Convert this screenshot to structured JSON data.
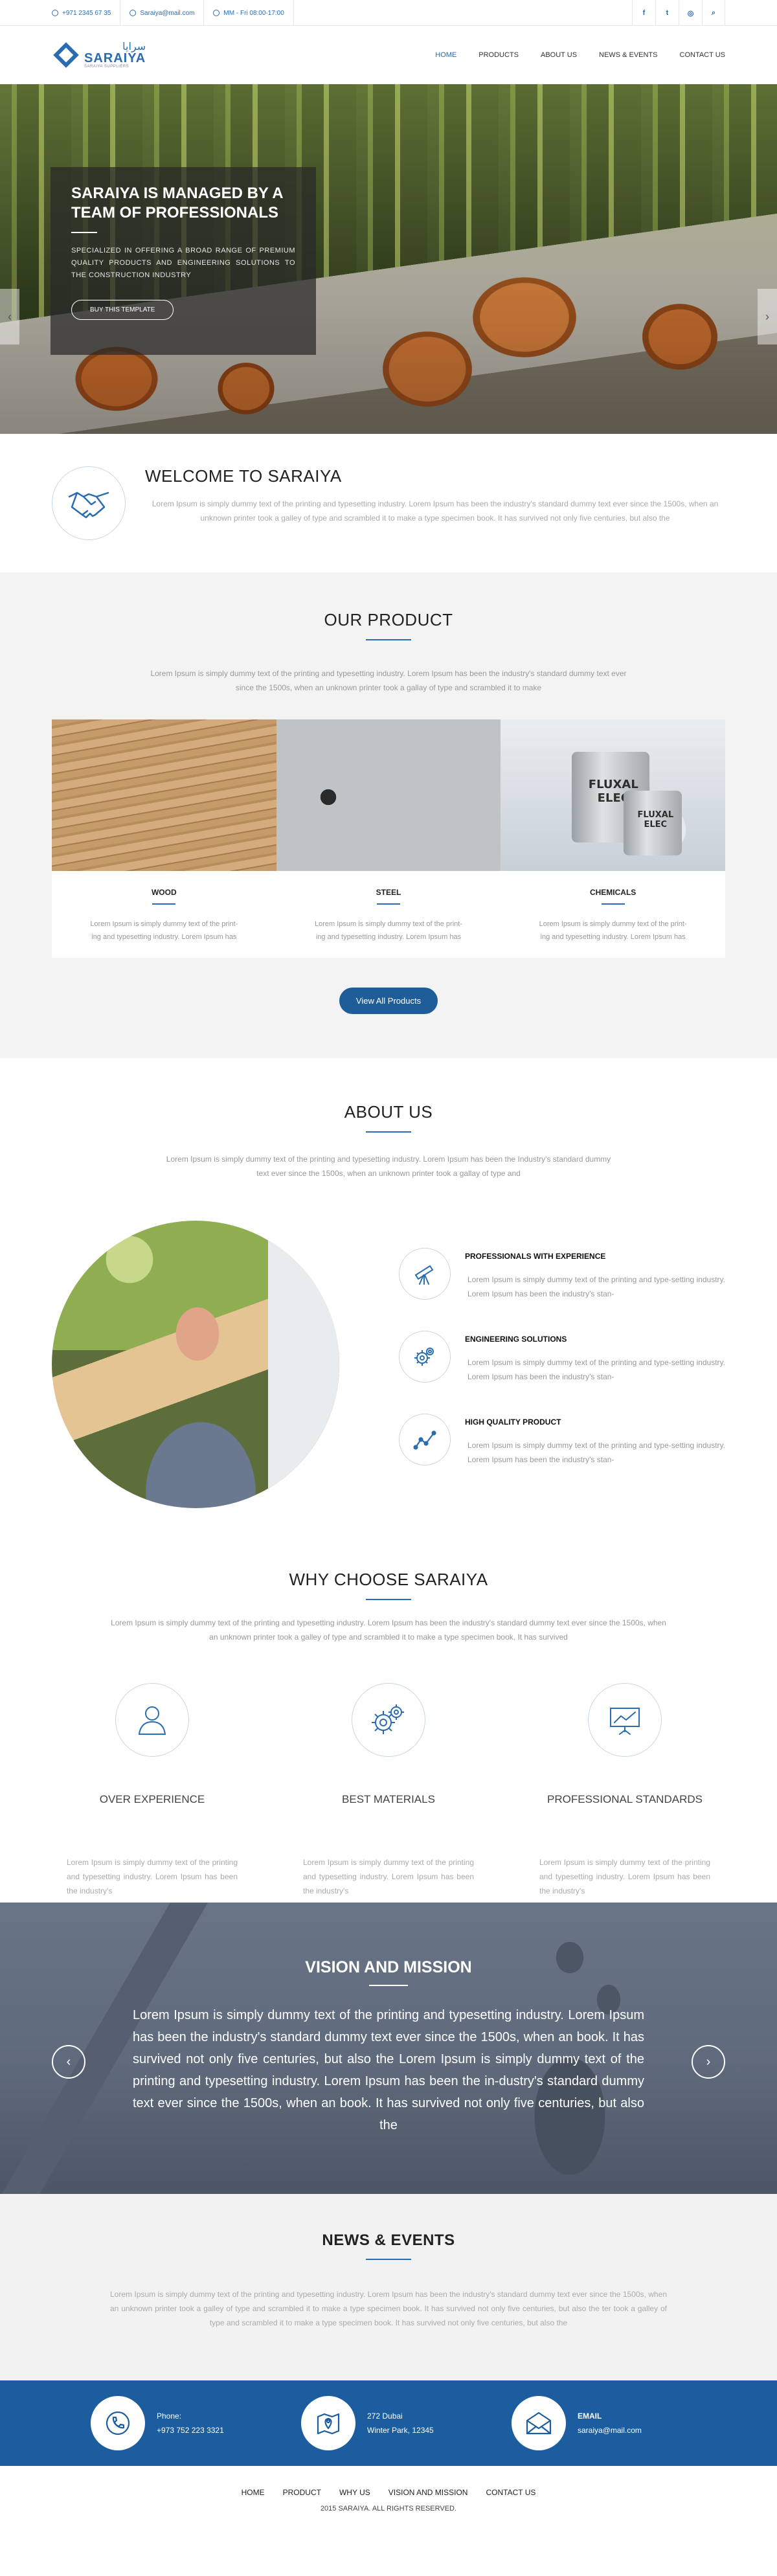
{
  "topbar": {
    "phone": "+971 2345 67 35",
    "email": "Saraiya@mail.com",
    "hours": "MM - Fri 08:00-17:00",
    "social": [
      "f",
      "t",
      "◎",
      "⌕"
    ]
  },
  "logo": {
    "arabic": "سرايا",
    "name": "SARAIYA",
    "tagline": "SARAIYA SUPPLIERS"
  },
  "nav": [
    {
      "label": "HOME"
    },
    {
      "label": "PRODUCTS"
    },
    {
      "label": "ABOUT US"
    },
    {
      "label": "NEWS & EVENTS"
    },
    {
      "label": "CONTACT US"
    }
  ],
  "hero": {
    "title": "SARAIYA  IS MANAGED BY A TEAM OF PROFESSIONALS",
    "text": "SPECIALIZED IN OFFERING A BROAD RANGE OF PREMIUM QUALITY PRODUCTS AND ENGINEERING SOLUTIONS TO THE CONSTRUCTION INDUSTRY",
    "button": "BUY THIS TEMPLATE",
    "prev": "‹",
    "next": "›"
  },
  "welcome": {
    "title": "WELCOME TO SARAIYA",
    "text": "Lorem Ipsum is simply dummy text of the printing and typesetting industry. Lorem Ipsum has been the industry's standard dummy text ever since the 1500s, when an unknown printer took a galley of type and scrambled it to make a type specimen book. It has survived not only five centuries, but also the"
  },
  "products": {
    "title": "OUR PRODUCT",
    "text": "Lorem Ipsum is simply dummy text of the printing and typesetting industry. Lorem Ipsum has been the industry's standard dummy text ever since the 1500s, when an unknown printer took a gallay of type and scrambled it to make",
    "items": [
      {
        "name": "WOOD",
        "text": "Lorem Ipsum is simply dummy text of the print-ing and typesetting industry. Lorem Ipsum has"
      },
      {
        "name": "STEEL",
        "text": "Lorem Ipsum is simply dummy text of the print-ing and typesetting industry. Lorem Ipsum has"
      },
      {
        "name": "CHEMICALS",
        "text": "Lorem Ipsum is simply dummy text of the print-ing and typesetting industry. Lorem Ipsum has"
      }
    ],
    "can_label_1": "FLUXAL ELEC",
    "can_label_2": "FLUXAL ELEC",
    "button": "View All Products"
  },
  "about": {
    "title": "ABOUT US",
    "text": "Lorem Ipsum is simply dummy text of the printing and typesetting industry. Lorem Ipsum has been the Industry's standard dummy text ever since the 1500s, when an unknown printer took a gallay of type and",
    "features": [
      {
        "title": "PROFESSIONALS WITH EXPERIENCE",
        "text": "Lorem Ipsum is simply dummy text of the printing and type-setting industry. Lorem Ipsum has been the industry's stan-",
        "icon": "telescope-icon"
      },
      {
        "title": "ENGINEERING SOLUTIONS",
        "text": "Lorem Ipsum is simply dummy text of the printing and type-setting industry. Lorem Ipsum has been the industry's stan-",
        "icon": "gears-icon"
      },
      {
        "title": "HIGH QUALITY PRODUCT",
        "text": "Lorem Ipsum is simply dummy text of the printing and type-setting industry. Lorem Ipsum has been the industry's stan-",
        "icon": "line-chart-icon"
      }
    ]
  },
  "why": {
    "title": "WHY CHOOSE SARAIYA",
    "text": "Lorem Ipsum is simply dummy text of the printing and typesetting industry. Lorem Ipsum has been the industry's standard dummy text ever since the 1500s, when an unknown printer took a galley of type and scrambled it to make a type specimen book. It has survived",
    "items": [
      {
        "name": "OVER EXPERIENCE",
        "text": "Lorem Ipsum is simply dummy text of the printing and typesetting industry. Lorem Ipsum has been the industry's",
        "icon": "user-icon"
      },
      {
        "name": "BEST MATERIALS",
        "text": "Lorem Ipsum is simply dummy text of the printing and typesetting industry. Lorem Ipsum has been the industry's",
        "icon": "gears-icon"
      },
      {
        "name": "PROFESSIONAL STANDARDS",
        "text": "Lorem Ipsum is simply dummy text of the printing and typesetting industry. Lorem Ipsum has been the industry's",
        "icon": "presentation-icon"
      }
    ]
  },
  "vision": {
    "title": "VISION AND MISSION",
    "text": "Lorem Ipsum is simply dummy text of the printing and typesetting industry. Lorem Ipsum has been the industry's standard dummy text ever since the 1500s, when an book. It has survived not only five centuries, but also the  Lorem Ipsum is simply dummy text of the printing and typesetting industry. Lorem Ipsum has been the in-dustry's standard dummy text ever since the 1500s, when an book. It has survived not only five centuries, but also the",
    "prev": "‹",
    "next": "›"
  },
  "news": {
    "title": "NEWS & EVENTS",
    "text": "Lorem Ipsum is simply dummy text of the printing and typesetting industry. Lorem Ipsum has been the industry's standard dummy text ever since the 1500s, when an unknown printer took a galley of type and scrambled it to make a type specimen book. It has survived not only five centuries, but also the  ter took a galley of type and scrambled it to make a type specimen book. It has survived not only five centuries, but also the"
  },
  "contact": {
    "phone_label": "Phone:",
    "phone": "+973 752 223 3321",
    "address_1": "272 Dubai",
    "address_2": "Winter Park, 12345",
    "email_label": "EMAIL",
    "email": "saraiya@mail.com"
  },
  "footer": {
    "links": [
      "HOME",
      "PRODUCT",
      "WHY US",
      "VISION AND MISSION",
      "CONTACT US"
    ],
    "copyright": "2015 SARAIYA. All rights reserved."
  },
  "colors": {
    "brand": "#2a6cb0",
    "contact_band": "#1b5d9f",
    "button": "#1f5d99"
  }
}
